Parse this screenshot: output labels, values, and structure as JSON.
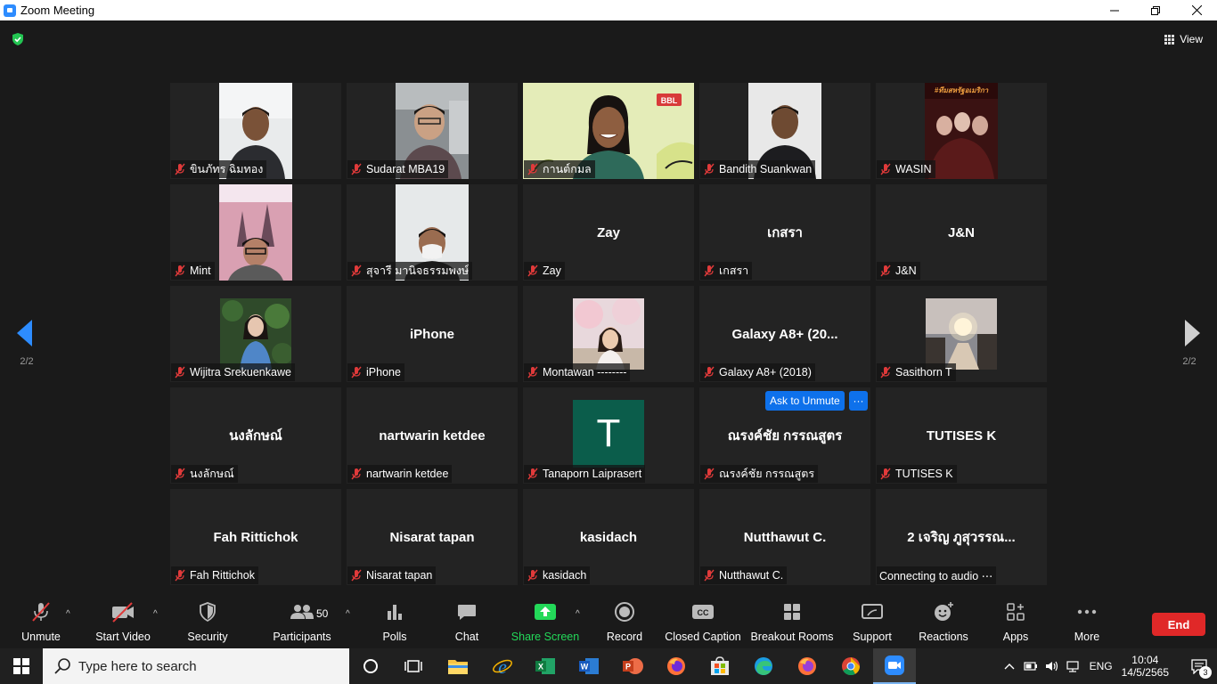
{
  "window": {
    "title": "Zoom Meeting"
  },
  "view": {
    "label": "View"
  },
  "pagination": {
    "left": "2/2",
    "right": "2/2"
  },
  "tiles": [
    {
      "name": "ขินภัทร ฉิมทอง",
      "big": ""
    },
    {
      "name": "Sudarat MBA19",
      "big": ""
    },
    {
      "name": "กานต์กมล",
      "big": ""
    },
    {
      "name": "Bandith Suankwan",
      "big": ""
    },
    {
      "name": "WASIN",
      "big": ""
    },
    {
      "name": "Mint",
      "big": ""
    },
    {
      "name": "สุจารี  มานิจธรรมพงษ์",
      "big": ""
    },
    {
      "name": "Zay",
      "big": "Zay"
    },
    {
      "name": "เกสรา",
      "big": "เกสรา"
    },
    {
      "name": "J&N",
      "big": "J&N"
    },
    {
      "name": "Wijitra Srekuenkawe",
      "big": ""
    },
    {
      "name": "iPhone",
      "big": "iPhone"
    },
    {
      "name": "Montawan --------",
      "big": ""
    },
    {
      "name": "Galaxy A8+ (2018)",
      "big": "Galaxy A8+ (20..."
    },
    {
      "name": "Sasithorn T",
      "big": ""
    },
    {
      "name": "นงลักษณ์",
      "big": "นงลักษณ์"
    },
    {
      "name": "nartwarin ketdee",
      "big": "nartwarin ketdee"
    },
    {
      "name": "Tanaporn Laiprasert",
      "big": "",
      "avatar": "T"
    },
    {
      "name": "ณรงค์ชัย กรรณสูตร",
      "big": "ณรงค์ชัย กรรณสูตร"
    },
    {
      "name": "TUTISES K",
      "big": "TUTISES K"
    },
    {
      "name": "Fah Rittichok",
      "big": "Fah Rittichok"
    },
    {
      "name": "Nisarat tapan",
      "big": "Nisarat tapan"
    },
    {
      "name": "kasidach",
      "big": "kasidach"
    },
    {
      "name": "Nutthawut C.",
      "big": "Nutthawut C."
    },
    {
      "name": "Connecting to audio ⋯",
      "big": "2 เจริญ ภูสุวรรณ..."
    }
  ],
  "hover": {
    "ask_unmute": "Ask to Unmute",
    "more": "···"
  },
  "toolbar": {
    "unmute": "Unmute",
    "start_video": "Start Video",
    "security": "Security",
    "participants": "Participants",
    "participants_count": "50",
    "polls": "Polls",
    "chat": "Chat",
    "share_screen": "Share Screen",
    "record": "Record",
    "closed_caption": "Closed Caption",
    "breakout_rooms": "Breakout Rooms",
    "support": "Support",
    "reactions": "Reactions",
    "apps": "Apps",
    "more": "More",
    "end": "End"
  },
  "taskbar": {
    "search_placeholder": "Type here to search",
    "lang": "ENG",
    "time": "10:04",
    "date": "14/5/2565",
    "notifications": "3"
  },
  "colors": {
    "accent_blue": "#0e71eb",
    "share_green": "#23d959",
    "end_red": "#e02828",
    "background": "#1a1a1a",
    "tile": "#232323"
  }
}
